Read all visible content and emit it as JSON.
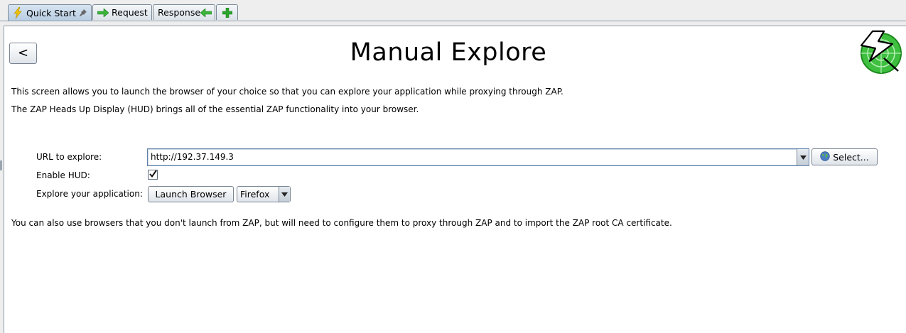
{
  "tabs": [
    {
      "label": "Quick Start",
      "icon": "lightning-icon",
      "pinned": true,
      "active": true
    },
    {
      "label": "Request",
      "icon": "arrow-right-icon",
      "active": false
    },
    {
      "label": "Response",
      "icon": "arrow-left-icon",
      "active": false
    },
    {
      "label": "",
      "icon": "plus-icon",
      "active": false
    }
  ],
  "header": {
    "back_label": "<",
    "title": "Manual Explore"
  },
  "description": {
    "line1": "This screen allows you to launch the browser of your choice so that you can explore your application while proxying through ZAP.",
    "line2": "The ZAP Heads Up Display (HUD) brings all of the essential ZAP functionality into your browser."
  },
  "form": {
    "url_label": "URL to explore:",
    "url_value": "http://192.37.149.3",
    "select_label": "Select...",
    "hud_label": "Enable HUD:",
    "hud_checked": true,
    "explore_label": "Explore your application:",
    "launch_label": "Launch Browser",
    "browser_value": "Firefox"
  },
  "footer_note": "You can also use browsers that you don't launch from ZAP, but will need to configure them to proxy through ZAP and to import the ZAP root CA certificate.",
  "colors": {
    "accent": "#4a74a8",
    "logo_green": "#3fbf3f",
    "plus_green": "#2aa52a"
  }
}
